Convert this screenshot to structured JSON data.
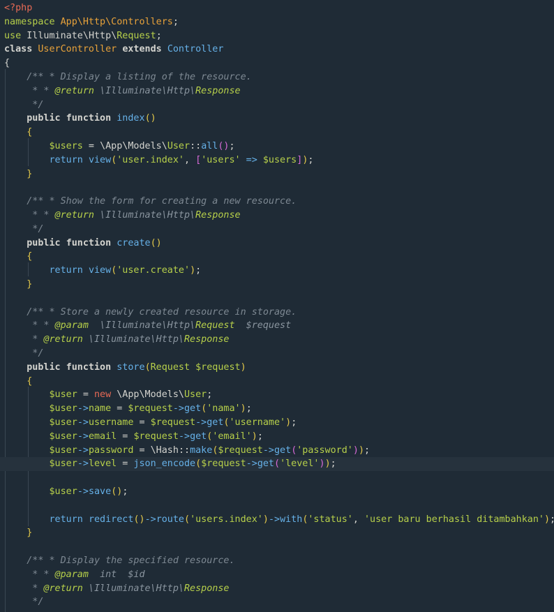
{
  "editor": {
    "language": "php",
    "colors": {
      "background": "#1f2b36",
      "current_line": "#26323d",
      "text": "#d4d4cf",
      "keyword_red": "#e86a55",
      "function_blue": "#66b1e8",
      "string_green": "#b7d04a",
      "class_orange": "#e8a23a",
      "comment_gray": "#7e8993",
      "bracket_yellow": "#e3c84a"
    },
    "current_line_index": 33,
    "lines": [
      [
        [
          "<?php",
          "tag"
        ]
      ],
      [
        [
          "namespace ",
          "nskw"
        ],
        [
          "App\\Http\\Controllers",
          "cls"
        ],
        [
          ";",
          "def"
        ]
      ],
      [
        [
          "use ",
          "nskw"
        ],
        [
          "Illuminate",
          "def"
        ],
        [
          "\\",
          "def"
        ],
        [
          "Http",
          "def"
        ],
        [
          "\\",
          "def"
        ],
        [
          "Request",
          "green"
        ],
        [
          ";",
          "def"
        ]
      ],
      [
        [
          "class ",
          "kw"
        ],
        [
          "UserController ",
          "cls"
        ],
        [
          "extends ",
          "kw"
        ],
        [
          "Controller",
          "blue"
        ]
      ],
      [
        [
          "{",
          "def"
        ]
      ],
      [
        [
          "    ",
          "def"
        ],
        [
          "/** * Display a listing of the resource.",
          "cmt"
        ]
      ],
      [
        [
          "     * * ",
          "cmt"
        ],
        [
          "@return ",
          "doctag"
        ],
        [
          "\\Illuminate\\Http\\",
          "doctype"
        ],
        [
          "Response",
          "doctag"
        ]
      ],
      [
        [
          "     */",
          "cmt"
        ]
      ],
      [
        [
          "    ",
          "def"
        ],
        [
          "public ",
          "kw"
        ],
        [
          "function ",
          "kw"
        ],
        [
          "index",
          "blue"
        ],
        [
          "()",
          "yel"
        ]
      ],
      [
        [
          "    ",
          "def"
        ],
        [
          "{",
          "yel"
        ]
      ],
      [
        [
          "        ",
          "def"
        ],
        [
          "$users",
          "green"
        ],
        [
          " = ",
          "def"
        ],
        [
          "\\App\\Models\\",
          "def"
        ],
        [
          "User",
          "green"
        ],
        [
          "::",
          "def"
        ],
        [
          "all",
          "blue"
        ],
        [
          "()",
          "mag"
        ],
        [
          ";",
          "def"
        ]
      ],
      [
        [
          "        ",
          "def"
        ],
        [
          "return ",
          "blue"
        ],
        [
          "view",
          "blue"
        ],
        [
          "(",
          "yel"
        ],
        [
          "'user.index'",
          "str"
        ],
        [
          ", ",
          "def"
        ],
        [
          "[",
          "mag"
        ],
        [
          "'users'",
          "str"
        ],
        [
          " => ",
          "blue"
        ],
        [
          "$users",
          "green"
        ],
        [
          "]",
          "mag"
        ],
        [
          ")",
          "yel"
        ],
        [
          ";",
          "def"
        ]
      ],
      [
        [
          "    ",
          "def"
        ],
        [
          "}",
          "yel"
        ]
      ],
      [
        [
          "",
          "def"
        ]
      ],
      [
        [
          "    ",
          "def"
        ],
        [
          "/** * Show the form for creating a new resource.",
          "cmt"
        ]
      ],
      [
        [
          "     * * ",
          "cmt"
        ],
        [
          "@return ",
          "doctag"
        ],
        [
          "\\Illuminate\\Http\\",
          "doctype"
        ],
        [
          "Response",
          "doctag"
        ]
      ],
      [
        [
          "     */",
          "cmt"
        ]
      ],
      [
        [
          "    ",
          "def"
        ],
        [
          "public ",
          "kw"
        ],
        [
          "function ",
          "kw"
        ],
        [
          "create",
          "blue"
        ],
        [
          "()",
          "yel"
        ]
      ],
      [
        [
          "    ",
          "def"
        ],
        [
          "{",
          "yel"
        ]
      ],
      [
        [
          "        ",
          "def"
        ],
        [
          "return ",
          "blue"
        ],
        [
          "view",
          "blue"
        ],
        [
          "(",
          "yel"
        ],
        [
          "'user.create'",
          "str"
        ],
        [
          ")",
          "yel"
        ],
        [
          ";",
          "def"
        ]
      ],
      [
        [
          "    ",
          "def"
        ],
        [
          "}",
          "yel"
        ]
      ],
      [
        [
          "",
          "def"
        ]
      ],
      [
        [
          "    ",
          "def"
        ],
        [
          "/** * Store a newly created resource in storage.",
          "cmt"
        ]
      ],
      [
        [
          "     * * ",
          "cmt"
        ],
        [
          "@param  ",
          "doctag"
        ],
        [
          "\\Illuminate\\Http\\",
          "doctype"
        ],
        [
          "Request",
          "doctag"
        ],
        [
          "  $request",
          "docvar"
        ]
      ],
      [
        [
          "     * ",
          "cmt"
        ],
        [
          "@return ",
          "doctag"
        ],
        [
          "\\Illuminate\\Http\\",
          "doctype"
        ],
        [
          "Response",
          "doctag"
        ]
      ],
      [
        [
          "     */",
          "cmt"
        ]
      ],
      [
        [
          "    ",
          "def"
        ],
        [
          "public ",
          "kw"
        ],
        [
          "function ",
          "kw"
        ],
        [
          "store",
          "blue"
        ],
        [
          "(",
          "yel"
        ],
        [
          "Request ",
          "green"
        ],
        [
          "$request",
          "green"
        ],
        [
          ")",
          "yel"
        ]
      ],
      [
        [
          "    ",
          "def"
        ],
        [
          "{",
          "yel"
        ]
      ],
      [
        [
          "        ",
          "def"
        ],
        [
          "$user",
          "green"
        ],
        [
          " = ",
          "def"
        ],
        [
          "new ",
          "red"
        ],
        [
          "\\App\\Models\\",
          "def"
        ],
        [
          "User",
          "green"
        ],
        [
          ";",
          "def"
        ]
      ],
      [
        [
          "        ",
          "def"
        ],
        [
          "$user",
          "green"
        ],
        [
          "->",
          "blue"
        ],
        [
          "name",
          "green"
        ],
        [
          " = ",
          "def"
        ],
        [
          "$request",
          "green"
        ],
        [
          "->",
          "blue"
        ],
        [
          "get",
          "blue"
        ],
        [
          "(",
          "yel"
        ],
        [
          "'nama'",
          "str"
        ],
        [
          ")",
          "yel"
        ],
        [
          ";",
          "def"
        ]
      ],
      [
        [
          "        ",
          "def"
        ],
        [
          "$user",
          "green"
        ],
        [
          "->",
          "blue"
        ],
        [
          "username",
          "green"
        ],
        [
          " = ",
          "def"
        ],
        [
          "$request",
          "green"
        ],
        [
          "->",
          "blue"
        ],
        [
          "get",
          "blue"
        ],
        [
          "(",
          "yel"
        ],
        [
          "'username'",
          "str"
        ],
        [
          ")",
          "yel"
        ],
        [
          ";",
          "def"
        ]
      ],
      [
        [
          "        ",
          "def"
        ],
        [
          "$user",
          "green"
        ],
        [
          "->",
          "blue"
        ],
        [
          "email",
          "green"
        ],
        [
          " = ",
          "def"
        ],
        [
          "$request",
          "green"
        ],
        [
          "->",
          "blue"
        ],
        [
          "get",
          "blue"
        ],
        [
          "(",
          "yel"
        ],
        [
          "'email'",
          "str"
        ],
        [
          ")",
          "yel"
        ],
        [
          ";",
          "def"
        ]
      ],
      [
        [
          "        ",
          "def"
        ],
        [
          "$user",
          "green"
        ],
        [
          "->",
          "blue"
        ],
        [
          "password",
          "green"
        ],
        [
          " = ",
          "def"
        ],
        [
          "\\Hash",
          "def"
        ],
        [
          "::",
          "def"
        ],
        [
          "make",
          "blue"
        ],
        [
          "(",
          "yel"
        ],
        [
          "$request",
          "green"
        ],
        [
          "->",
          "blue"
        ],
        [
          "get",
          "blue"
        ],
        [
          "(",
          "mag"
        ],
        [
          "'password'",
          "str"
        ],
        [
          ")",
          "mag"
        ],
        [
          ")",
          "yel"
        ],
        [
          ";",
          "def"
        ]
      ],
      [
        [
          "        ",
          "def"
        ],
        [
          "$user",
          "green"
        ],
        [
          "->",
          "blue"
        ],
        [
          "level",
          "green"
        ],
        [
          " = ",
          "def"
        ],
        [
          "json_encode",
          "blue"
        ],
        [
          "(",
          "yel"
        ],
        [
          "$request",
          "green"
        ],
        [
          "->",
          "blue"
        ],
        [
          "get",
          "blue"
        ],
        [
          "(",
          "mag"
        ],
        [
          "'level'",
          "str"
        ],
        [
          ")",
          "mag"
        ],
        [
          ")",
          "yel"
        ],
        [
          ";",
          "def"
        ]
      ],
      [
        [
          "",
          "def"
        ]
      ],
      [
        [
          "        ",
          "def"
        ],
        [
          "$user",
          "green"
        ],
        [
          "->",
          "blue"
        ],
        [
          "save",
          "blue"
        ],
        [
          "()",
          "yel"
        ],
        [
          ";",
          "def"
        ]
      ],
      [
        [
          "",
          "def"
        ]
      ],
      [
        [
          "        ",
          "def"
        ],
        [
          "return ",
          "blue"
        ],
        [
          "redirect",
          "blue"
        ],
        [
          "()",
          "yel"
        ],
        [
          "->",
          "blue"
        ],
        [
          "route",
          "blue"
        ],
        [
          "(",
          "yel"
        ],
        [
          "'users.index'",
          "str"
        ],
        [
          ")",
          "yel"
        ],
        [
          "->",
          "blue"
        ],
        [
          "with",
          "blue"
        ],
        [
          "(",
          "yel"
        ],
        [
          "'status'",
          "str"
        ],
        [
          ", ",
          "def"
        ],
        [
          "'user baru berhasil ditambahkan'",
          "str"
        ],
        [
          ")",
          "yel"
        ],
        [
          ";",
          "def"
        ]
      ],
      [
        [
          "    ",
          "def"
        ],
        [
          "}",
          "yel"
        ]
      ],
      [
        [
          "",
          "def"
        ]
      ],
      [
        [
          "    ",
          "def"
        ],
        [
          "/** * Display the specified resource.",
          "cmt"
        ]
      ],
      [
        [
          "     * * ",
          "cmt"
        ],
        [
          "@param  ",
          "doctag"
        ],
        [
          "int  ",
          "doctype"
        ],
        [
          "$id",
          "docvar"
        ]
      ],
      [
        [
          "     * ",
          "cmt"
        ],
        [
          "@return ",
          "doctag"
        ],
        [
          "\\Illuminate\\Http\\",
          "doctype"
        ],
        [
          "Response",
          "doctag"
        ]
      ],
      [
        [
          "     */",
          "cmt"
        ]
      ]
    ]
  }
}
